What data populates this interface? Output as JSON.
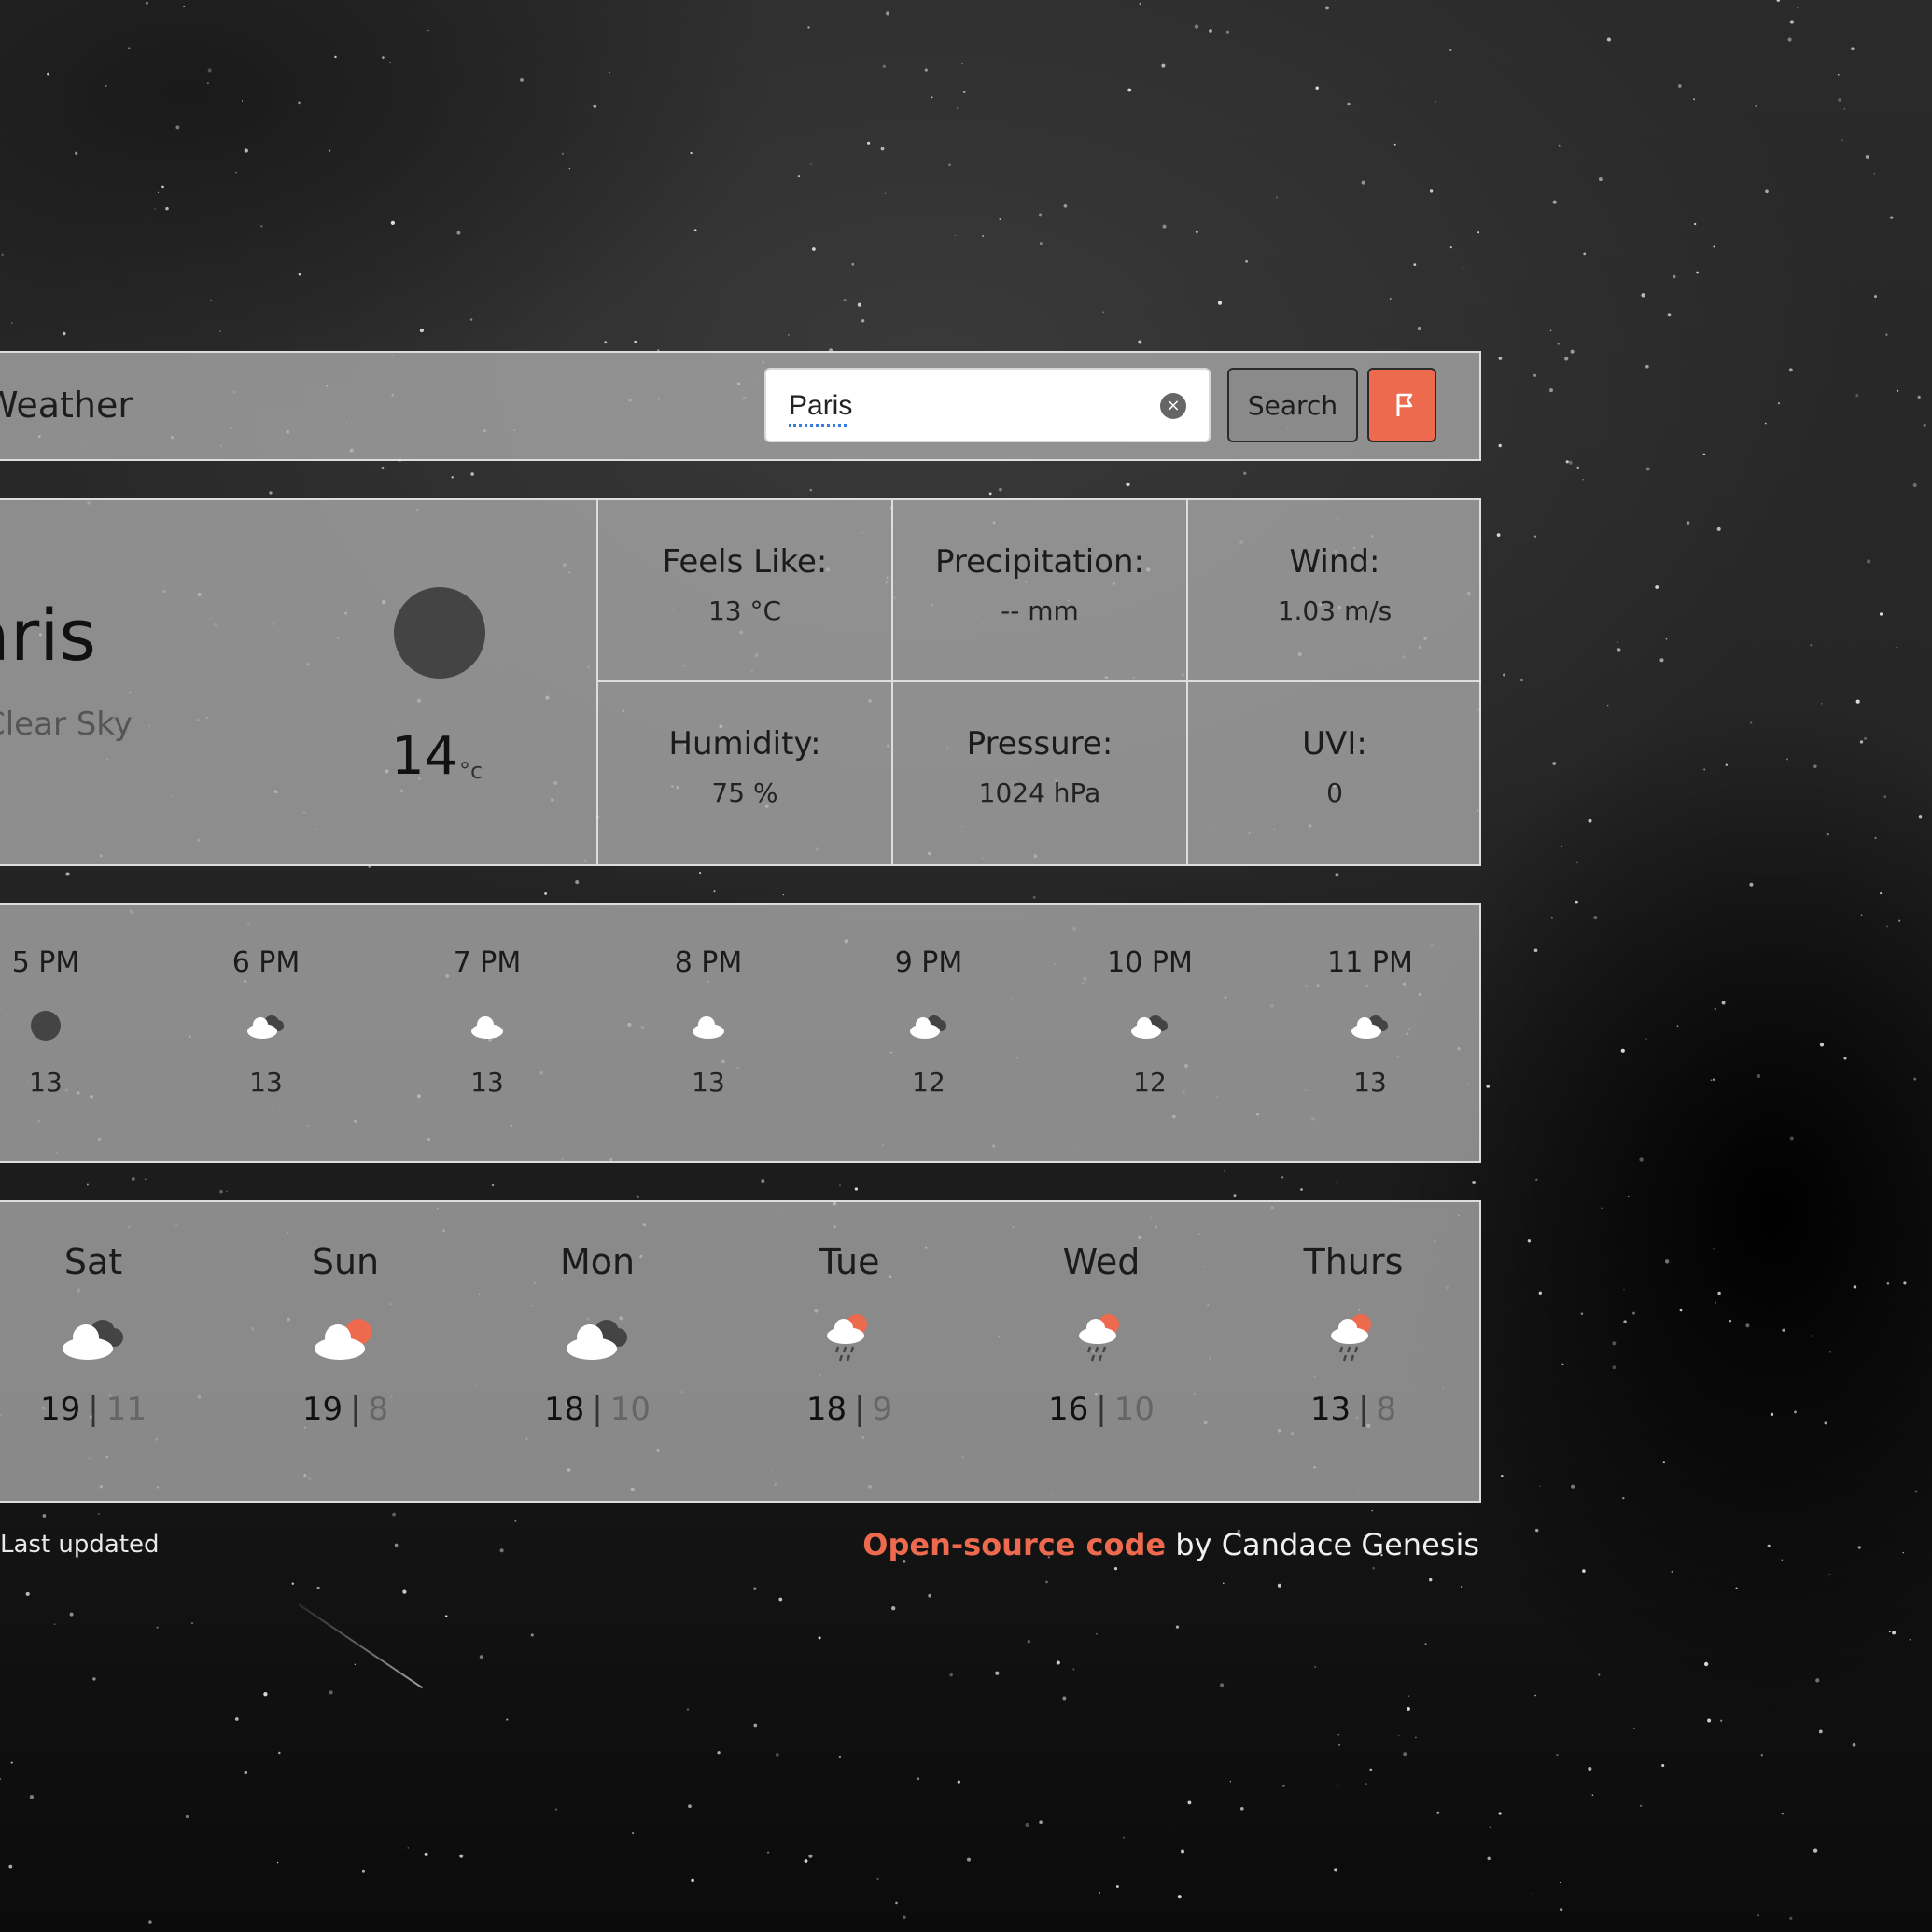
{
  "header": {
    "title": "Weather",
    "search_value": "Paris",
    "clear_icon": "×",
    "search_label": "Search"
  },
  "current": {
    "city": "Paris",
    "condition": "Clear Sky",
    "temperature": "14",
    "unit": "°c",
    "icon": "moon-icon"
  },
  "details": [
    {
      "label": "Feels Like:",
      "value": "13 °C"
    },
    {
      "label": "Precipitation:",
      "value": "-- mm"
    },
    {
      "label": "Wind:",
      "value": "1.03 m/s"
    },
    {
      "label": "Humidity:",
      "value": "75 %"
    },
    {
      "label": "Pressure:",
      "value": "1024 hPa"
    },
    {
      "label": "UVI:",
      "value": "0"
    }
  ],
  "hourly": [
    {
      "time": "5 PM",
      "icon": "moon-icon",
      "temp": "13"
    },
    {
      "time": "6 PM",
      "icon": "cloud-dark-icon",
      "temp": "13"
    },
    {
      "time": "7 PM",
      "icon": "cloud-icon",
      "temp": "13"
    },
    {
      "time": "8 PM",
      "icon": "cloud-icon",
      "temp": "13"
    },
    {
      "time": "9 PM",
      "icon": "cloud-dark-icon",
      "temp": "12"
    },
    {
      "time": "10 PM",
      "icon": "cloud-dark-icon",
      "temp": "12"
    },
    {
      "time": "11 PM",
      "icon": "cloud-dark-icon",
      "temp": "13"
    }
  ],
  "daily": [
    {
      "day": "Sat",
      "icon": "cloud-dark-icon",
      "high": "19",
      "low": "11"
    },
    {
      "day": "Sun",
      "icon": "cloud-sun-icon",
      "high": "19",
      "low": "8"
    },
    {
      "day": "Mon",
      "icon": "cloud-dark-icon",
      "high": "18",
      "low": "10"
    },
    {
      "day": "Tue",
      "icon": "rain-sun-icon",
      "high": "18",
      "low": "9"
    },
    {
      "day": "Wed",
      "icon": "rain-sun-icon",
      "high": "16",
      "low": "10"
    },
    {
      "day": "Thurs",
      "icon": "rain-sun-icon",
      "high": "13",
      "low": "8"
    }
  ],
  "footer": {
    "updated": "Last updated",
    "link_text": "Open-source code",
    "by_text": " by Candace Genesis"
  },
  "colors": {
    "accent": "#ee6a4f",
    "panel": "#aaaaaa"
  }
}
